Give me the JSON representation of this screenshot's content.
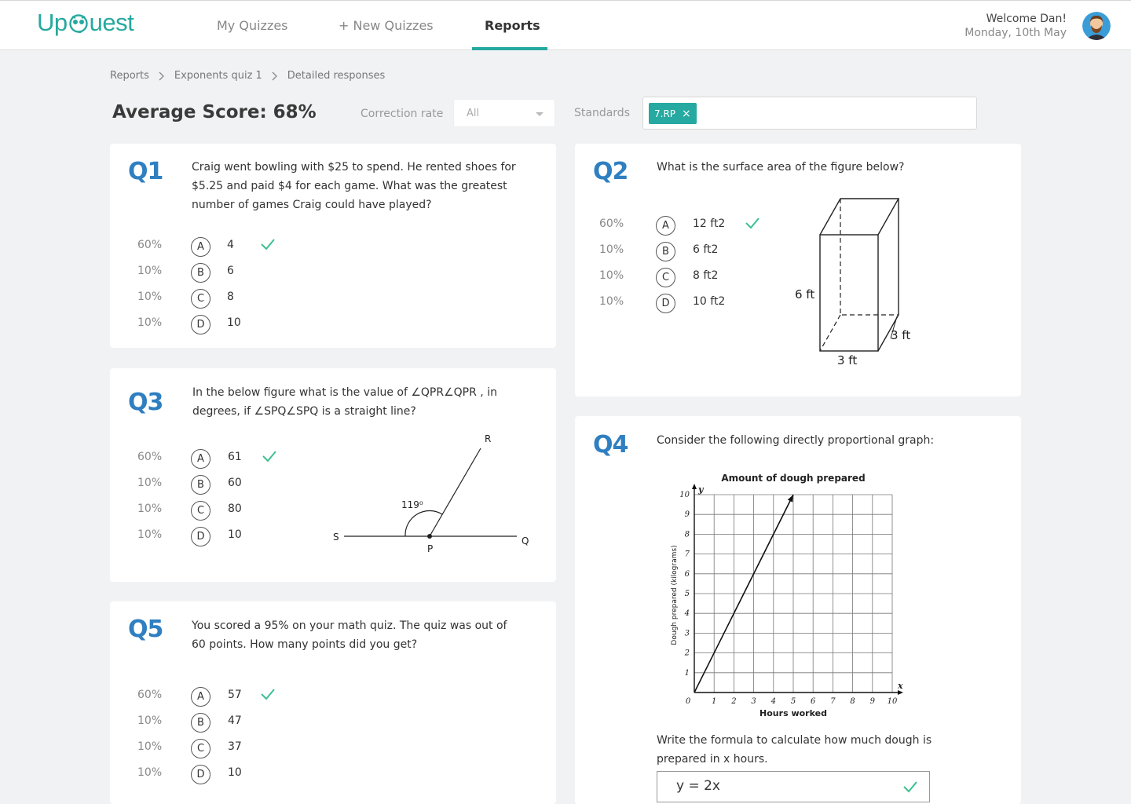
{
  "header": {
    "logo_left": "Up",
    "logo_right": "uest",
    "nav": [
      {
        "label": "My Quizzes"
      },
      {
        "label": "+ New Quizzes"
      },
      {
        "label": "Reports"
      }
    ],
    "welcome": "Welcome Dan!",
    "date": "Monday, 10th May"
  },
  "breadcrumb": [
    "Reports",
    "Exponents quiz 1",
    "Detailed responses"
  ],
  "filters": {
    "average_score": "Average Score: 68%",
    "correction_label": "Correction rate",
    "correction_value": "All",
    "standards_label": "Standards",
    "standard_tag": "7.RP"
  },
  "accent": "#26a9a0",
  "question_color": "#2f7fc1",
  "q1": {
    "num": "Q1",
    "text": "Craig went bowling with $25 to spend. He rented shoes for $5.25 and paid $4 for each game. What was the greatest number of games Craig could have played?",
    "options": [
      {
        "pct": "60%",
        "letter": "A",
        "value": "4",
        "correct": true
      },
      {
        "pct": "10%",
        "letter": "B",
        "value": "6"
      },
      {
        "pct": "10%",
        "letter": "C",
        "value": "8"
      },
      {
        "pct": "10%",
        "letter": "D",
        "value": "10"
      }
    ]
  },
  "q2": {
    "num": "Q2",
    "text": "What is the surface area of the figure below?",
    "options": [
      {
        "pct": "60%",
        "letter": "A",
        "value": "12 ft2",
        "correct": true
      },
      {
        "pct": "10%",
        "letter": "B",
        "value": "6  ft2"
      },
      {
        "pct": "10%",
        "letter": "C",
        "value": "8  ft2"
      },
      {
        "pct": "10%",
        "letter": "D",
        "value": "10 ft2"
      }
    ],
    "figure": {
      "height": "6 ft",
      "depth": "3 ft",
      "width": "3 ft"
    }
  },
  "q3": {
    "num": "Q3",
    "text_1": "In the below figure what is the value of  ∠QPR∠QPR , in",
    "text_2": "degrees, if  ∠SPQ∠SPQ  is a straight line?",
    "options": [
      {
        "pct": "60%",
        "letter": "A",
        "value": "61",
        "correct": true
      },
      {
        "pct": "10%",
        "letter": "B",
        "value": "60"
      },
      {
        "pct": "10%",
        "letter": "C",
        "value": "80"
      },
      {
        "pct": "10%",
        "letter": "D",
        "value": "10"
      }
    ],
    "figure": {
      "r": "R",
      "s": "S",
      "p": "P",
      "q": "Q",
      "angle": "119⁰"
    }
  },
  "q4": {
    "num": "Q4",
    "text": "Consider the following directly proportional graph:",
    "prompt": "Write the formula to calculate how much dough is prepared in  x  hours.",
    "answer": "y = 2x"
  },
  "q5": {
    "num": "Q5",
    "text": "You scored a 95% on your math quiz.  The quiz was out of 60 points.  How many points did you get?",
    "options": [
      {
        "pct": "60%",
        "letter": "A",
        "value": "57",
        "correct": true
      },
      {
        "pct": "10%",
        "letter": "B",
        "value": "47"
      },
      {
        "pct": "10%",
        "letter": "C",
        "value": "37"
      },
      {
        "pct": "10%",
        "letter": "D",
        "value": "10"
      }
    ]
  },
  "chart_data": {
    "type": "line",
    "title": "Amount of dough prepared",
    "xlabel": "Hours worked",
    "ylabel": "Dough prepared (kilograms)",
    "x_axis_letter": "x",
    "y_axis_letter": "y",
    "xlim": [
      0,
      10
    ],
    "ylim": [
      0,
      10
    ],
    "x_ticks": [
      "0",
      "1",
      "2",
      "3",
      "4",
      "5",
      "6",
      "7",
      "8",
      "9",
      "10"
    ],
    "y_ticks": [
      "1",
      "2",
      "3",
      "4",
      "5",
      "6",
      "7",
      "8",
      "9",
      "10"
    ],
    "grid": true,
    "series": [
      {
        "x": [
          0,
          5
        ],
        "y": [
          0,
          10
        ]
      }
    ]
  }
}
